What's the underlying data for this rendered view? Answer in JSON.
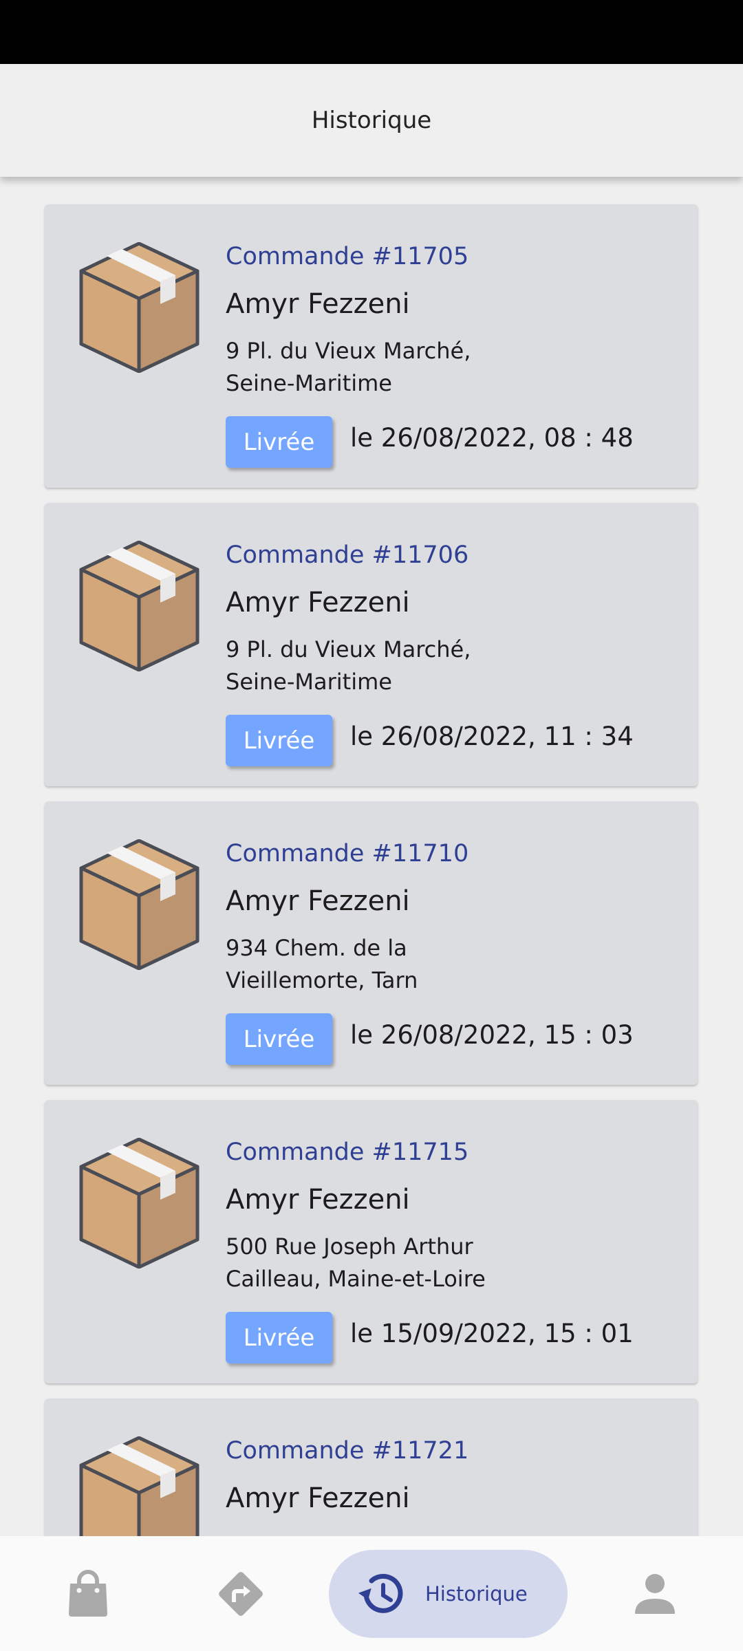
{
  "header": {
    "title": "Historique"
  },
  "orders": [
    {
      "order_no": "Commande #11705",
      "customer": "Amyr Fezzeni",
      "address_line1": "9 Pl. du Vieux Marché,",
      "address_line2": "Seine-Maritime",
      "status": "Livrée",
      "date": "le 26/08/2022, 08 : 48"
    },
    {
      "order_no": "Commande #11706",
      "customer": "Amyr Fezzeni",
      "address_line1": "9 Pl. du Vieux Marché,",
      "address_line2": "Seine-Maritime",
      "status": "Livrée",
      "date": "le 26/08/2022, 11 : 34"
    },
    {
      "order_no": "Commande #11710",
      "customer": "Amyr Fezzeni",
      "address_line1": "934 Chem. de la",
      "address_line2": "Vieillemorte, Tarn",
      "status": "Livrée",
      "date": "le 26/08/2022, 15 : 03"
    },
    {
      "order_no": "Commande #11715",
      "customer": "Amyr Fezzeni",
      "address_line1": "500 Rue Joseph Arthur",
      "address_line2": "Cailleau, Maine-et-Loire",
      "status": "Livrée",
      "date": "le 15/09/2022, 15 : 01"
    },
    {
      "order_no": "Commande #11721",
      "customer": "Amyr Fezzeni",
      "address_line1": "",
      "address_line2": "",
      "status": "",
      "date": ""
    }
  ],
  "bottom_nav": {
    "items": [
      {
        "icon": "shopping-bag-icon"
      },
      {
        "icon": "route-turn-icon"
      },
      {
        "icon": "history-icon",
        "label": "Historique",
        "active": true
      },
      {
        "icon": "person-icon"
      }
    ]
  },
  "colors": {
    "accent": "#2f3f93",
    "chip": "#74a6ff",
    "card": "#dcdde0",
    "nav_active_bg": "#d5d9ee",
    "box_front": "#c59b74",
    "box_top": "#d8ae83"
  }
}
